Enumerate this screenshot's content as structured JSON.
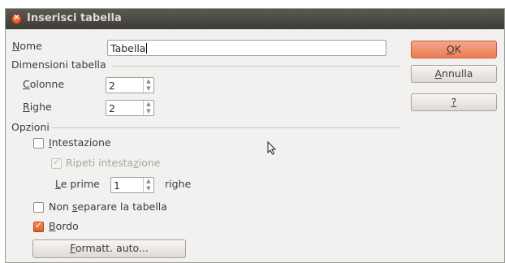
{
  "window": {
    "title": "Inserisci tabella"
  },
  "name_row": {
    "label_u": "N",
    "label_rest": "ome",
    "value": "Tabella"
  },
  "dimensions": {
    "heading": "Dimensioni tabella",
    "columns": {
      "label_u": "C",
      "label_rest": "olonne",
      "value": "2"
    },
    "rows": {
      "label_u": "R",
      "label_rest": "ighe",
      "value": "2"
    }
  },
  "options": {
    "heading": "Opzioni",
    "header": {
      "label_u": "I",
      "label_rest": "ntestazione",
      "checked": false
    },
    "repeat_header": {
      "label_pre": "Ripeti intesta",
      "label_u": "z",
      "label_post": "ione",
      "checked": true,
      "disabled": true
    },
    "first_rows": {
      "label_u": "L",
      "label_rest": "e prime",
      "value": "1",
      "suffix": "righe"
    },
    "no_split": {
      "label_pre": "Non ",
      "label_u": "s",
      "label_post": "eparare la tabella",
      "checked": false
    },
    "border": {
      "label_u": "B",
      "label_rest": "ordo",
      "checked": true
    },
    "autoformat": {
      "label_u": "F",
      "label_rest": "ormatt. auto..."
    }
  },
  "buttons": {
    "ok": {
      "label_u": "O",
      "label_rest": "K"
    },
    "cancel": {
      "label_u": "A",
      "label_rest": "nnulla"
    },
    "help": {
      "label_u": "?",
      "label_rest": ""
    }
  },
  "icons": {
    "close": "close-icon",
    "pointer": "mouse-pointer-icon"
  },
  "colors": {
    "accent": "#ec7d54",
    "titlebar": "#3d3c38"
  }
}
